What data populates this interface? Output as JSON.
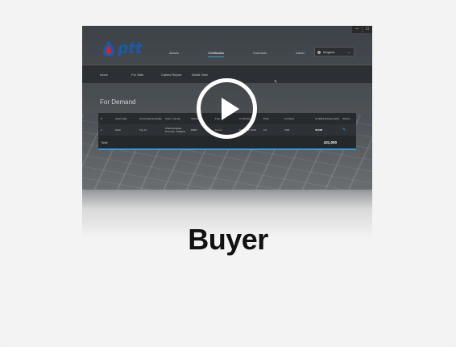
{
  "video": {
    "window_controls": [
      "–",
      "□"
    ],
    "app": {
      "logo_text": "ptt",
      "nav": [
        "Assets",
        "Certificates",
        "Contracts",
        "Admin"
      ],
      "active_nav": "Certificates",
      "user_name": "Kingnes",
      "subnav": [
        "Inbox",
        "For Sale",
        "Claims Report",
        "Detail View"
      ],
      "page_title": "For Demand",
      "table": {
        "headers": [
          "#",
          "Asset Type",
          "Commissioning Date",
          "Town, Country",
          "Volume",
          "Fuel",
          "Certificate",
          "Price",
          "Currency",
          "Certified Energy (kwh)",
          "Actions"
        ],
        "rows": [
          [
            "1",
            "Solar",
            "Tue 14",
            "Chachoengsao Province, Thailand",
            "MWD",
            "Lorem",
            "Energy ID 2019",
            "2.0",
            "USD",
            "40,000",
            "✎"
          ]
        ],
        "footer_label": "Total",
        "footer_total": "431,000"
      }
    },
    "play_button_label": "Play video"
  },
  "caption": "Buyer",
  "colors": {
    "accent": "#3a9ad9",
    "logo_blue": "#1c5aa8",
    "logo_red": "#d8232a",
    "caption": "#111111"
  },
  "icons": [
    "ptt-logo-icon",
    "play-icon",
    "edit-icon",
    "user-avatar-icon",
    "chevron-down-icon",
    "cursor-icon"
  ]
}
